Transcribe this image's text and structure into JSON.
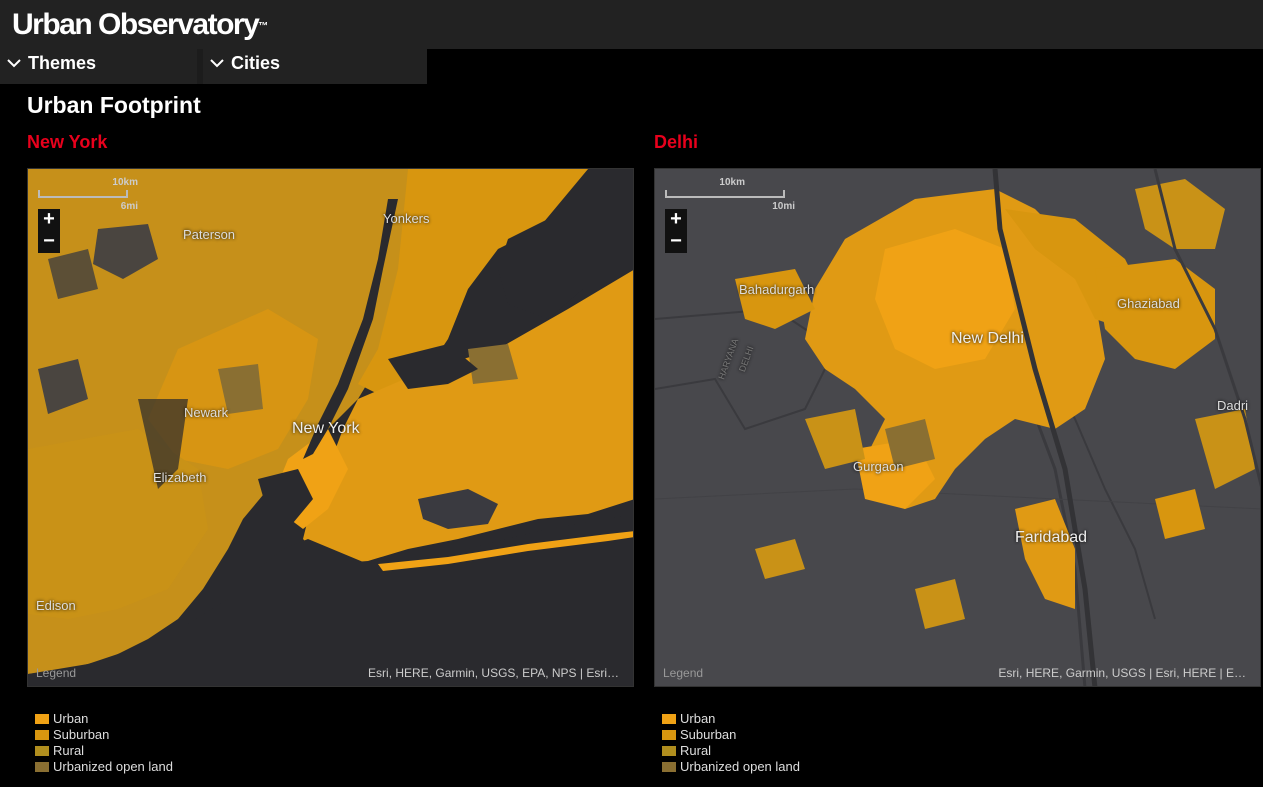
{
  "app": {
    "title": "Urban Observatory",
    "trademark": "™"
  },
  "menus": [
    {
      "label": "Themes"
    },
    {
      "label": "Cities"
    }
  ],
  "page_title": "Urban Footprint",
  "colors": {
    "urban": "#f0a215",
    "suburban": "#d8960f",
    "rural": "#b08e1e",
    "urbanized_open_land": "#8a6f32",
    "city_title": "#e8001c"
  },
  "maps": [
    {
      "city": "New York",
      "scale": {
        "km": "10km",
        "mi": "6mi"
      },
      "zoom_in": "+",
      "zoom_out": "−",
      "places": [
        "Paterson",
        "Yonkers",
        "Newark",
        "New York",
        "Elizabeth",
        "Edison"
      ],
      "legend_link": "Legend",
      "attribution": "Esri, HERE, Garmin, USGS, EPA, NPS | Esri…"
    },
    {
      "city": "Delhi",
      "scale": {
        "km": "10km",
        "mi": "10mi"
      },
      "zoom_in": "+",
      "zoom_out": "−",
      "places": [
        "Bahadurgarh",
        "Ghaziabad",
        "New Delhi",
        "Dadri",
        "Gurgaon",
        "Faridabad",
        "HARYANA",
        "DELHI"
      ],
      "legend_link": "Legend",
      "attribution": "Esri, HERE, Garmin, USGS | Esri, HERE | E…"
    }
  ],
  "legend": [
    {
      "label": "Urban",
      "color": "#f0a215"
    },
    {
      "label": "Suburban",
      "color": "#d8960f"
    },
    {
      "label": "Rural",
      "color": "#b08e1e"
    },
    {
      "label": "Urbanized open land",
      "color": "#8a6f32"
    }
  ]
}
